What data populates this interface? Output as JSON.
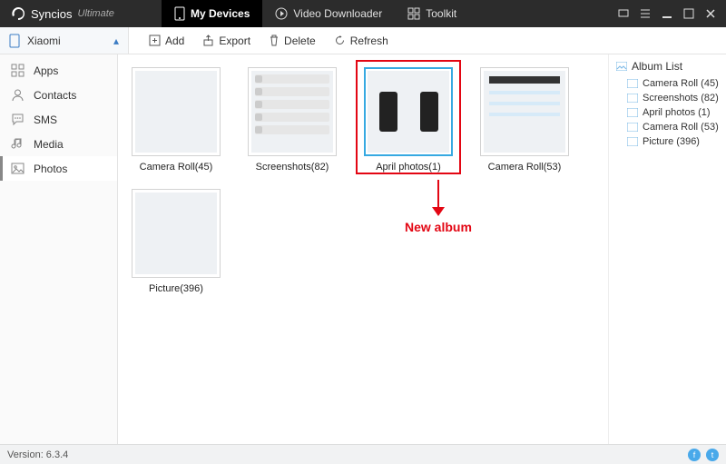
{
  "app": {
    "brand": "Syncios",
    "edition": "Ultimate"
  },
  "tabs": {
    "devices": "My Devices",
    "downloader": "Video Downloader",
    "toolkit": "Toolkit"
  },
  "device": {
    "name": "Xiaomi"
  },
  "actions": {
    "add": "Add",
    "export": "Export",
    "delete": "Delete",
    "refresh": "Refresh"
  },
  "sidebar": {
    "apps": "Apps",
    "contacts": "Contacts",
    "sms": "SMS",
    "media": "Media",
    "photos": "Photos"
  },
  "albums": [
    {
      "label": "Camera Roll(45)"
    },
    {
      "label": "Screenshots(82)"
    },
    {
      "label": "April photos(1)"
    },
    {
      "label": "Camera Roll(53)"
    },
    {
      "label": "Picture(396)"
    }
  ],
  "annotation": {
    "label": "New album"
  },
  "albumlist": {
    "header": "Album List",
    "items": [
      "Camera Roll (45)",
      "Screenshots (82)",
      "April photos (1)",
      "Camera Roll (53)",
      "Picture (396)"
    ]
  },
  "status": {
    "version": "Version: 6.3.4"
  }
}
